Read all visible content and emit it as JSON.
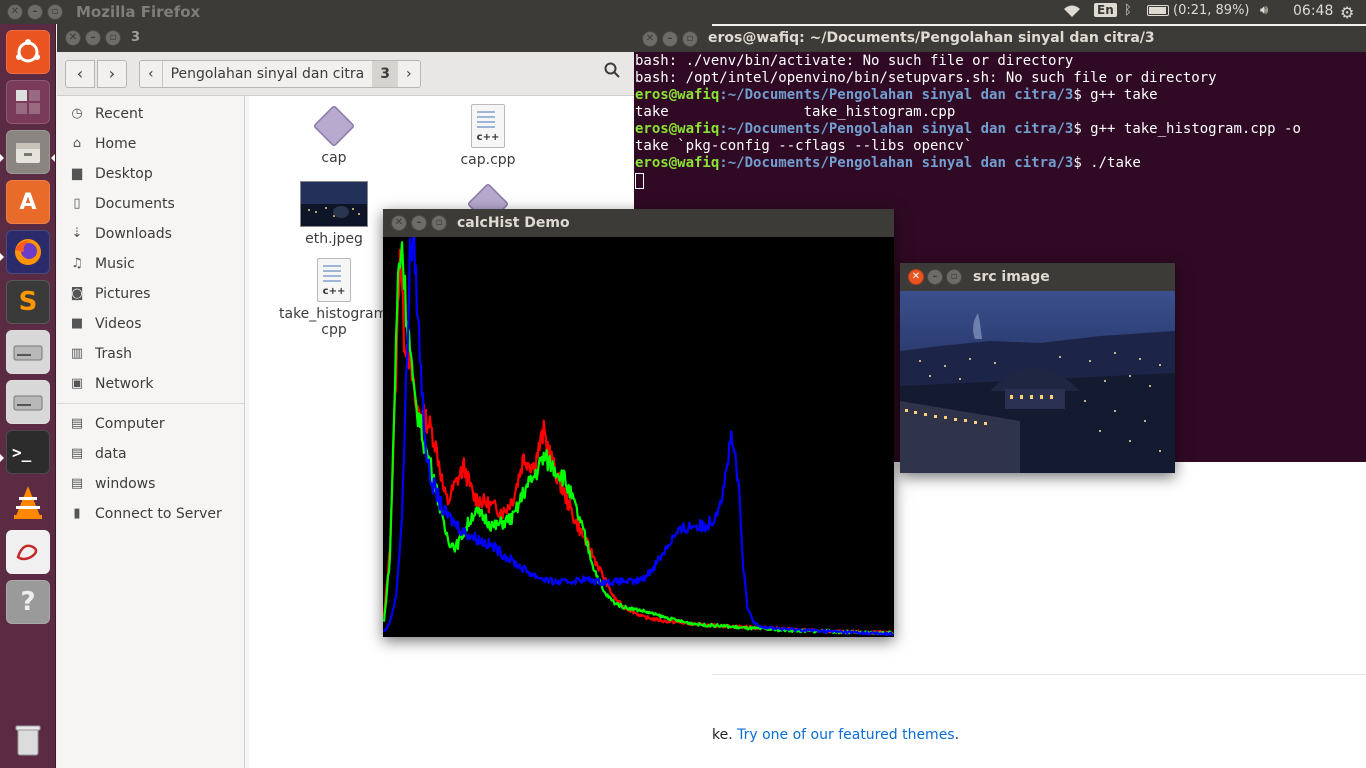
{
  "top_panel": {
    "title": "Mozilla Firefox",
    "keyboard": "En",
    "battery": "(0:21, 89%)",
    "clock": "06:48"
  },
  "launcher": {
    "items": [
      "ubuntu-dash",
      "workspace-switcher",
      "files",
      "ubuntu-software",
      "firefox",
      "sublime-text",
      "drive",
      "drive",
      "terminal",
      "vlc",
      "mendeley",
      "help",
      "trash"
    ]
  },
  "firefox": {
    "themes_prefix": "ke. ",
    "themes_link": "Try one of our featured themes",
    "themes_suffix": "."
  },
  "nautilus": {
    "window_title": "3",
    "path": [
      "Pengolahan sinyal dan citra",
      "3"
    ],
    "sidebar": [
      {
        "label": "Recent",
        "icon": "clock-icon"
      },
      {
        "label": "Home",
        "icon": "home-icon"
      },
      {
        "label": "Desktop",
        "icon": "folder-icon"
      },
      {
        "label": "Documents",
        "icon": "document-icon"
      },
      {
        "label": "Downloads",
        "icon": "download-icon"
      },
      {
        "label": "Music",
        "icon": "music-icon"
      },
      {
        "label": "Pictures",
        "icon": "camera-icon"
      },
      {
        "label": "Videos",
        "icon": "video-icon"
      },
      {
        "label": "Trash",
        "icon": "trash-icon"
      },
      {
        "label": "Network",
        "icon": "network-icon"
      },
      {
        "label": "Computer",
        "icon": "drive-icon"
      },
      {
        "label": "data",
        "icon": "drive-icon"
      },
      {
        "label": "windows",
        "icon": "drive-icon"
      },
      {
        "label": "Connect to Server",
        "icon": "server-icon"
      }
    ],
    "files": [
      {
        "name": "cap",
        "type": "binary"
      },
      {
        "name": "cap.cpp",
        "type": "cpp"
      },
      {
        "name": "eth.jpeg",
        "type": "image"
      },
      {
        "name": "",
        "type": "binary"
      },
      {
        "name": "take_histogram.cpp",
        "line1": "take_histogram.",
        "line2": "cpp",
        "type": "cpp"
      }
    ],
    "cpp_badge": "c++"
  },
  "terminal": {
    "title": "eros@wafiq: ~/Documents/Pengolahan sinyal dan citra/3",
    "prompt_user": "eros@wafiq",
    "prompt_path": ":~/Documents/Pengolahan sinyal dan citra/3",
    "prompt_sign": "$ ",
    "lines": [
      {
        "type": "out",
        "text": "bash: ./venv/bin/activate: No such file or directory"
      },
      {
        "type": "out",
        "text": "bash: /opt/intel/openvino/bin/setupvars.sh: No such file or directory"
      },
      {
        "type": "cmd",
        "text": "g++ take"
      },
      {
        "type": "out",
        "text": "take                take_histogram.cpp"
      },
      {
        "type": "cmd",
        "text": "g++ take_histogram.cpp -o"
      },
      {
        "type": "out",
        "text": "take `pkg-config --cflags --libs opencv`"
      },
      {
        "type": "cmd",
        "text": "./take"
      }
    ]
  },
  "hist_window": {
    "title": "calcHist Demo"
  },
  "src_window": {
    "title": "src image"
  },
  "chart_data": {
    "type": "line",
    "title": "",
    "xlabel": "",
    "ylabel": "",
    "xlim": [
      0,
      255
    ],
    "ylim": [
      0,
      400
    ],
    "grid": false,
    "background": "#000000",
    "series": [
      {
        "color": "#ff0000",
        "points": [
          [
            0,
            20
          ],
          [
            3,
            90
          ],
          [
            6,
            260
          ],
          [
            8,
            395
          ],
          [
            10,
            300
          ],
          [
            12,
            290
          ],
          [
            14,
            260
          ],
          [
            16,
            230
          ],
          [
            18,
            225
          ],
          [
            20,
            220
          ],
          [
            22,
            215
          ],
          [
            25,
            200
          ],
          [
            28,
            170
          ],
          [
            30,
            145
          ],
          [
            32,
            135
          ],
          [
            35,
            150
          ],
          [
            40,
            170
          ],
          [
            45,
            140
          ],
          [
            50,
            135
          ],
          [
            55,
            130
          ],
          [
            60,
            125
          ],
          [
            65,
            140
          ],
          [
            70,
            180
          ],
          [
            75,
            170
          ],
          [
            80,
            205
          ],
          [
            85,
            170
          ],
          [
            90,
            145
          ],
          [
            95,
            120
          ],
          [
            100,
            100
          ],
          [
            105,
            80
          ],
          [
            110,
            60
          ],
          [
            115,
            40
          ],
          [
            120,
            30
          ],
          [
            130,
            20
          ],
          [
            140,
            16
          ],
          [
            150,
            14
          ],
          [
            160,
            12
          ],
          [
            170,
            11
          ],
          [
            180,
            10
          ],
          [
            190,
            9
          ],
          [
            200,
            8
          ],
          [
            210,
            7
          ],
          [
            220,
            6
          ],
          [
            230,
            5
          ],
          [
            240,
            5
          ],
          [
            255,
            4
          ]
        ]
      },
      {
        "color": "#00ff00",
        "points": [
          [
            0,
            15
          ],
          [
            3,
            80
          ],
          [
            5,
            220
          ],
          [
            7,
            360
          ],
          [
            9,
            395
          ],
          [
            11,
            330
          ],
          [
            13,
            290
          ],
          [
            15,
            240
          ],
          [
            18,
            215
          ],
          [
            20,
            195
          ],
          [
            22,
            180
          ],
          [
            25,
            160
          ],
          [
            28,
            130
          ],
          [
            30,
            110
          ],
          [
            33,
            95
          ],
          [
            36,
            90
          ],
          [
            40,
            105
          ],
          [
            45,
            125
          ],
          [
            50,
            120
          ],
          [
            55,
            110
          ],
          [
            60,
            115
          ],
          [
            65,
            120
          ],
          [
            70,
            145
          ],
          [
            75,
            160
          ],
          [
            80,
            180
          ],
          [
            85,
            170
          ],
          [
            90,
            160
          ],
          [
            95,
            135
          ],
          [
            100,
            105
          ],
          [
            105,
            70
          ],
          [
            110,
            45
          ],
          [
            115,
            35
          ],
          [
            120,
            30
          ],
          [
            125,
            28
          ],
          [
            130,
            26
          ],
          [
            140,
            20
          ],
          [
            150,
            15
          ],
          [
            160,
            12
          ],
          [
            170,
            11
          ],
          [
            180,
            9
          ],
          [
            190,
            8
          ],
          [
            200,
            7
          ],
          [
            210,
            6
          ],
          [
            220,
            6
          ],
          [
            230,
            5
          ],
          [
            240,
            4
          ],
          [
            255,
            4
          ]
        ]
      },
      {
        "color": "#0000ff",
        "points": [
          [
            0,
            5
          ],
          [
            3,
            15
          ],
          [
            6,
            40
          ],
          [
            9,
            120
          ],
          [
            11,
            250
          ],
          [
            13,
            380
          ],
          [
            15,
            400
          ],
          [
            17,
            320
          ],
          [
            19,
            250
          ],
          [
            21,
            190
          ],
          [
            23,
            160
          ],
          [
            26,
            145
          ],
          [
            30,
            125
          ],
          [
            35,
            115
          ],
          [
            40,
            105
          ],
          [
            45,
            100
          ],
          [
            50,
            95
          ],
          [
            55,
            90
          ],
          [
            60,
            82
          ],
          [
            65,
            75
          ],
          [
            70,
            68
          ],
          [
            75,
            62
          ],
          [
            80,
            58
          ],
          [
            85,
            55
          ],
          [
            90,
            55
          ],
          [
            95,
            56
          ],
          [
            100,
            58
          ],
          [
            105,
            56
          ],
          [
            110,
            55
          ],
          [
            115,
            55
          ],
          [
            120,
            56
          ],
          [
            125,
            55
          ],
          [
            130,
            58
          ],
          [
            135,
            70
          ],
          [
            140,
            85
          ],
          [
            145,
            100
          ],
          [
            150,
            108
          ],
          [
            155,
            112
          ],
          [
            160,
            110
          ],
          [
            165,
            118
          ],
          [
            170,
            145
          ],
          [
            172,
            175
          ],
          [
            174,
            195
          ],
          [
            176,
            180
          ],
          [
            178,
            140
          ],
          [
            180,
            70
          ],
          [
            182,
            30
          ],
          [
            185,
            15
          ],
          [
            190,
            10
          ],
          [
            200,
            8
          ],
          [
            210,
            7
          ],
          [
            220,
            6
          ],
          [
            230,
            5
          ],
          [
            240,
            4
          ],
          [
            255,
            3
          ]
        ]
      }
    ]
  }
}
